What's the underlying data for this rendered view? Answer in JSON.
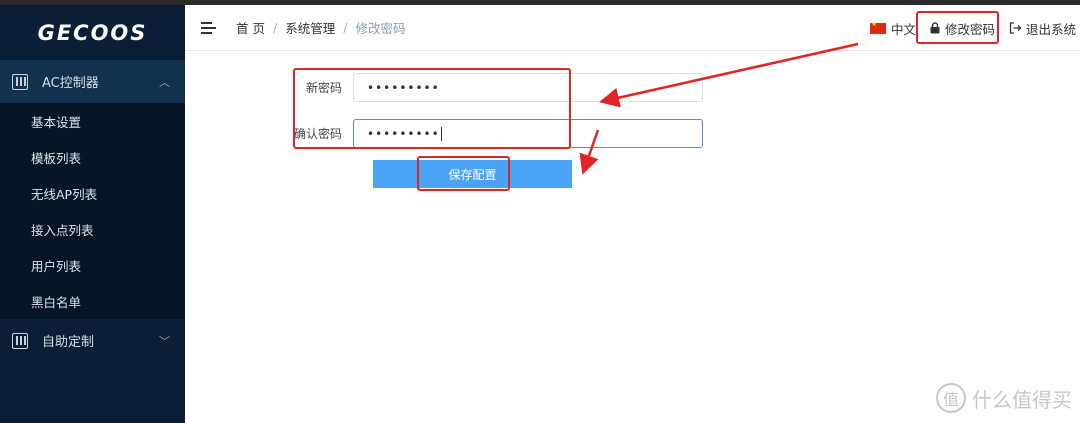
{
  "sidebar": {
    "logo": "GECOOS",
    "groups": [
      {
        "label": "AC控制器",
        "icon": "sliders-icon",
        "chevron": "chevron-up-icon"
      },
      {
        "label": "自助定制",
        "icon": "sliders-icon",
        "chevron": "chevron-down-icon"
      }
    ],
    "items": [
      {
        "label": "基本设置"
      },
      {
        "label": "模板列表"
      },
      {
        "label": "无线AP列表"
      },
      {
        "label": "接入点列表"
      },
      {
        "label": "用户列表"
      },
      {
        "label": "黑白名单"
      }
    ]
  },
  "header": {
    "breadcrumb": [
      "首 页",
      "系统管理",
      "修改密码"
    ],
    "breadcrumb_sep": "/",
    "language": "中文",
    "change_password": "修改密码",
    "logout": "退出系统"
  },
  "form": {
    "new_password_label": "新密码",
    "new_password_value": "•••••••••",
    "confirm_password_label": "确认密码",
    "confirm_password_value": "•••••••••",
    "save_label": "保存配置"
  },
  "watermark": {
    "logo": "值",
    "text": "什么值得买"
  },
  "colors": {
    "sidebar_bg": "#0a1f36",
    "primary": "#4aa3f5",
    "annotation_red": "#e02525"
  }
}
